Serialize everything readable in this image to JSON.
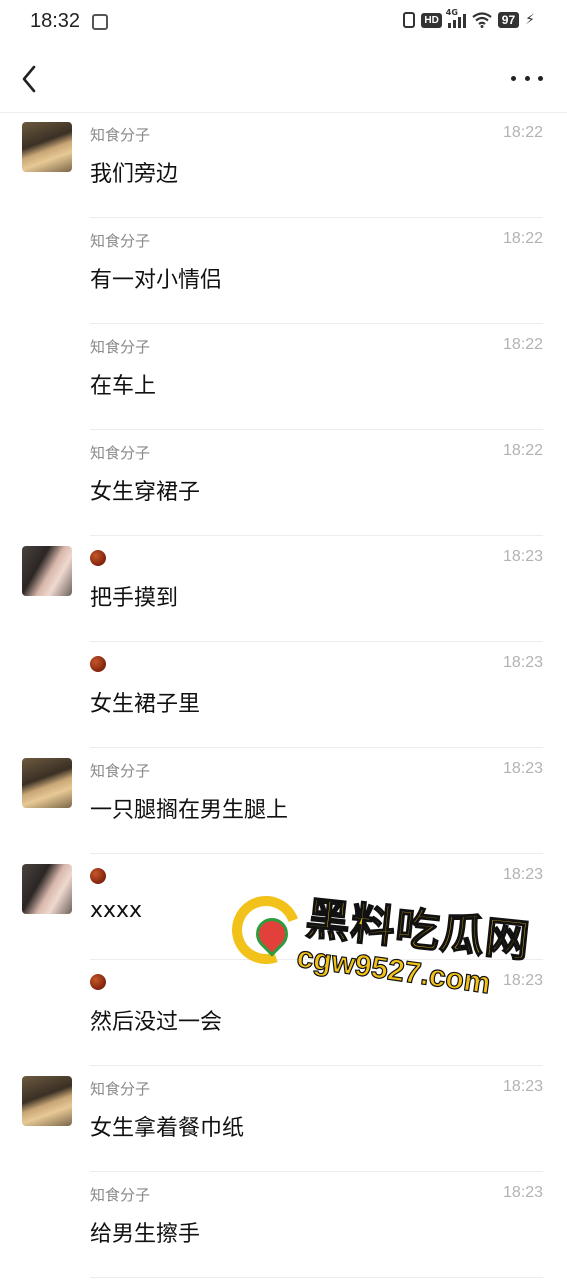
{
  "status_bar": {
    "time": "18:32",
    "hd_label": "HD",
    "network_label": "4G",
    "battery_level": "97"
  },
  "messages": [
    {
      "sender": "知食分子",
      "avatar": "dog-avatar",
      "time": "18:22",
      "text": "我们旁边"
    },
    {
      "sender": "知食分子",
      "time": "18:22",
      "text": "有一对小情侣"
    },
    {
      "sender": "知食分子",
      "time": "18:22",
      "text": "在车上"
    },
    {
      "sender": "知食分子",
      "time": "18:22",
      "text": "女生穿裙子"
    },
    {
      "sender_icon": "chestnut-icon",
      "avatar": "girl-avatar",
      "time": "18:23",
      "text": "把手摸到"
    },
    {
      "sender_icon": "chestnut-icon",
      "time": "18:23",
      "text": "女生裙子里"
    },
    {
      "sender": "知食分子",
      "avatar": "dog-avatar",
      "time": "18:23",
      "text": "一只腿搁在男生腿上"
    },
    {
      "sender_icon": "chestnut-icon",
      "avatar": "girl-avatar",
      "time": "18:23",
      "text": "xxxx"
    },
    {
      "sender_icon": "chestnut-icon",
      "time": "18:23",
      "text": "然后没过一会"
    },
    {
      "sender": "知食分子",
      "avatar": "dog-avatar",
      "time": "18:23",
      "text": "女生拿着餐巾纸"
    },
    {
      "sender": "知食分子",
      "time": "18:23",
      "text": "给男生擦手"
    }
  ],
  "watermark": {
    "title": "黑料吃瓜网",
    "url": "cgw9527.com"
  },
  "colors": {
    "background": "#ffffff",
    "name_text": "#8a8a8a",
    "time_text": "#b3b3b3",
    "watermark_yellow": "#f2c21a"
  }
}
